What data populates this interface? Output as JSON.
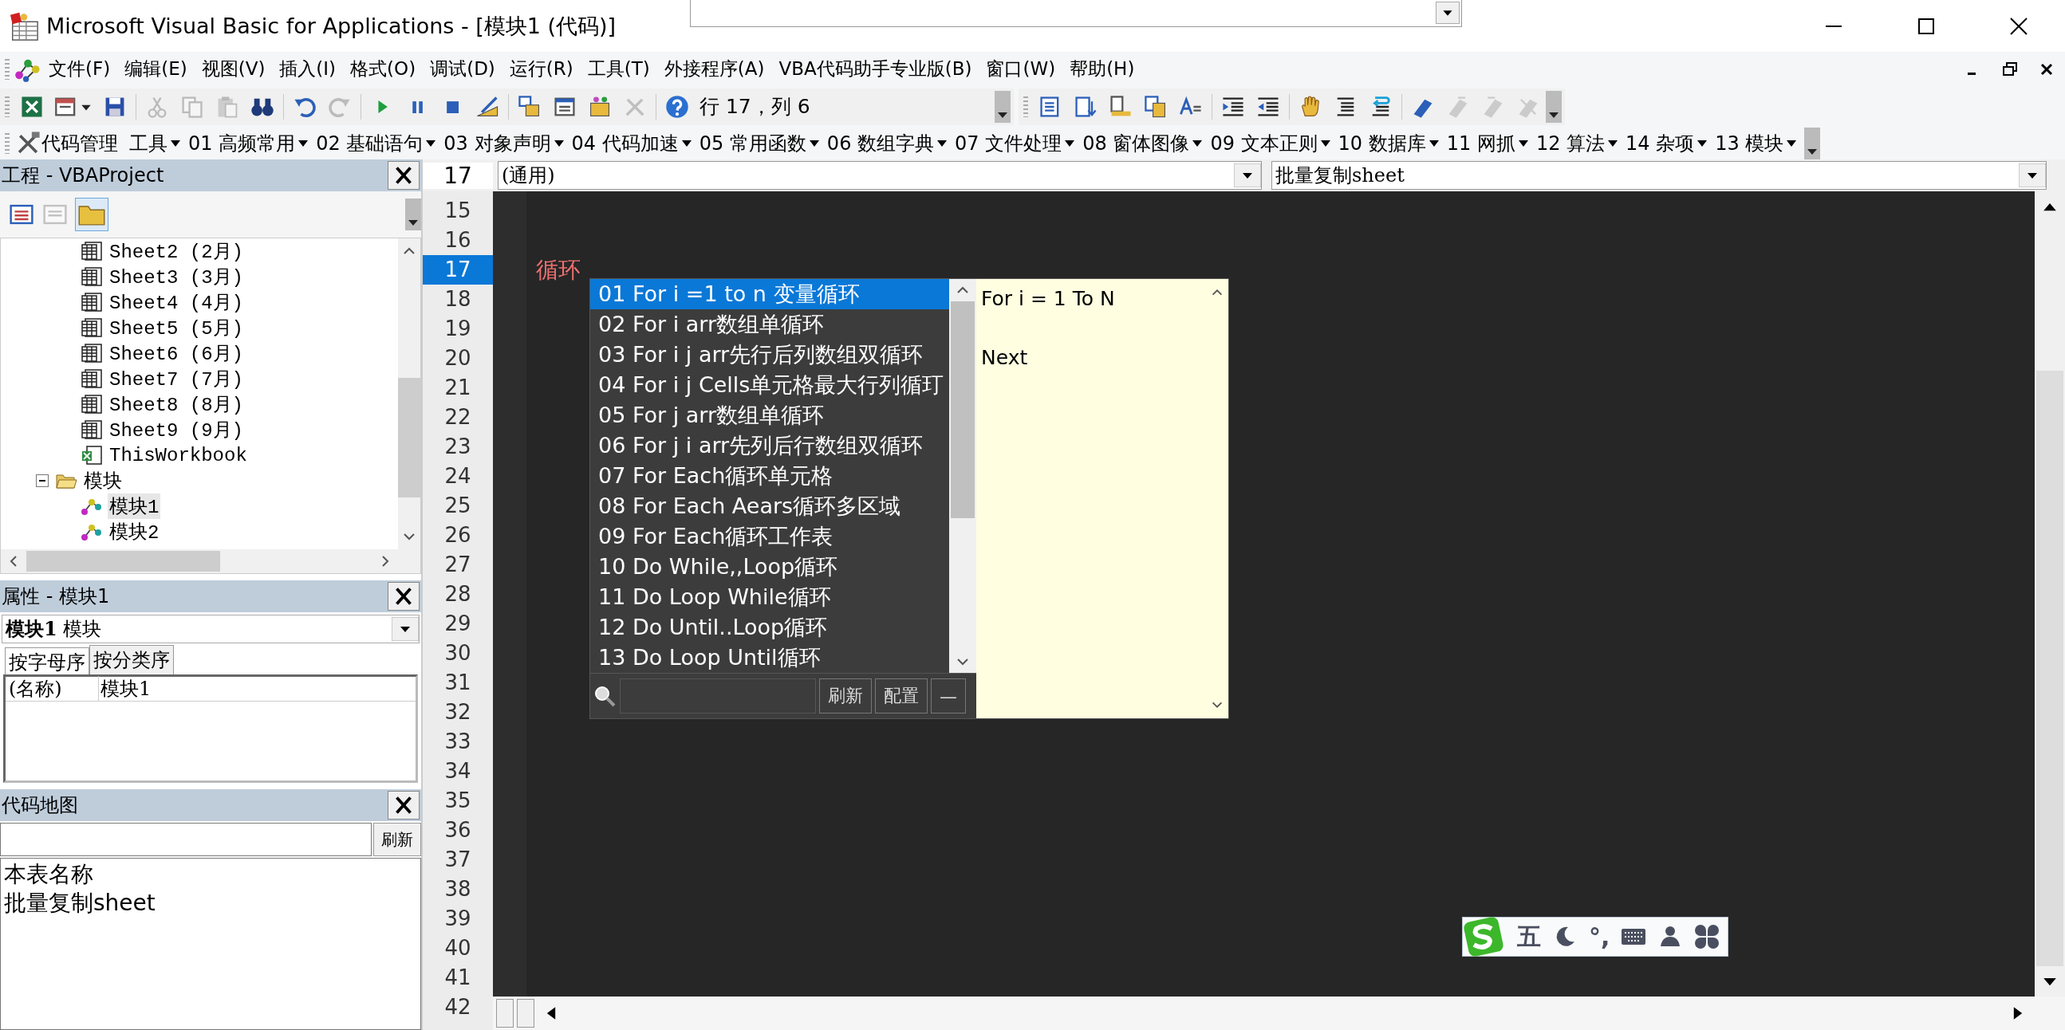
{
  "window": {
    "title": "Microsoft Visual Basic for Applications - [模块1 (代码)]"
  },
  "menu": [
    "文件(F)",
    "编辑(E)",
    "视图(V)",
    "插入(I)",
    "格式(O)",
    "调试(D)",
    "运行(R)",
    "工具(T)",
    "外接程序(A)",
    "VBA代码助手专业版(B)",
    "窗口(W)",
    "帮助(H)"
  ],
  "standard_toolbar": {
    "items": [
      {
        "kind": "spreadsheet",
        "disabled": false
      },
      {
        "kind": "window-dropdown",
        "disabled": false
      },
      {
        "kind": "save",
        "disabled": false
      },
      {
        "kind": "separator"
      },
      {
        "kind": "scissors",
        "disabled": true
      },
      {
        "kind": "copy",
        "disabled": true
      },
      {
        "kind": "paste",
        "disabled": true
      },
      {
        "kind": "binoculars",
        "disabled": false
      },
      {
        "kind": "separator"
      },
      {
        "kind": "undo",
        "disabled": false
      },
      {
        "kind": "redo",
        "disabled": true
      },
      {
        "kind": "separator"
      },
      {
        "kind": "play",
        "disabled": false
      },
      {
        "kind": "pause",
        "disabled": false
      },
      {
        "kind": "stop",
        "disabled": false
      },
      {
        "kind": "ruler",
        "disabled": false
      },
      {
        "kind": "separator"
      },
      {
        "kind": "project",
        "disabled": false
      },
      {
        "kind": "properties",
        "disabled": false
      },
      {
        "kind": "objects",
        "disabled": false
      },
      {
        "kind": "tools",
        "disabled": true
      },
      {
        "kind": "separator"
      },
      {
        "kind": "help",
        "disabled": false
      }
    ],
    "position": "行 17，列 6"
  },
  "edit_toolbar": {
    "items": [
      {
        "kind": "list",
        "disabled": false
      },
      {
        "kind": "doc-arrow",
        "disabled": false
      },
      {
        "kind": "ruler-doc",
        "disabled": false
      },
      {
        "kind": "documents",
        "disabled": false
      },
      {
        "kind": "text-size",
        "disabled": false
      },
      {
        "kind": "separator"
      },
      {
        "kind": "indent",
        "disabled": false
      },
      {
        "kind": "outdent",
        "disabled": false
      },
      {
        "kind": "separator"
      },
      {
        "kind": "hand",
        "disabled": false
      },
      {
        "kind": "lines",
        "disabled": false
      },
      {
        "kind": "wrap-lines",
        "disabled": false
      },
      {
        "kind": "separator"
      },
      {
        "kind": "bookmark",
        "disabled": false
      },
      {
        "kind": "bookmark-next",
        "disabled": true
      },
      {
        "kind": "bookmark-prev",
        "disabled": true
      },
      {
        "kind": "bookmark-clear",
        "disabled": true
      }
    ]
  },
  "addin_toolbar": {
    "title": "代码管理",
    "menus": [
      "工具",
      "01 高频常用",
      "02 基础语句",
      "03 对象声明",
      "04 代码加速",
      "05 常用函数",
      "06 数组字典",
      "07 文件处理",
      "08 窗体图像",
      "09 文本正则",
      "10 数据库",
      "11 网抓",
      "12 算法",
      "14 杂项",
      "13 模块"
    ]
  },
  "project_panel": {
    "title": "工程 - VBAProject",
    "tree": [
      {
        "kind": "scrolled-parent",
        "children": [
          {
            "kind": "sheet",
            "label": "Sheet2 (2月)",
            "selected": false
          },
          {
            "kind": "sheet",
            "label": "Sheet3 (3月)",
            "selected": false
          },
          {
            "kind": "sheet",
            "label": "Sheet4 (4月)",
            "selected": false
          },
          {
            "kind": "sheet",
            "label": "Sheet5 (5月)",
            "selected": false
          },
          {
            "kind": "sheet",
            "label": "Sheet6 (6月)",
            "selected": false
          },
          {
            "kind": "sheet",
            "label": "Sheet7 (7月)",
            "selected": false
          },
          {
            "kind": "sheet",
            "label": "Sheet8 (8月)",
            "selected": false
          },
          {
            "kind": "sheet",
            "label": "Sheet9 (9月)",
            "selected": false
          },
          {
            "kind": "workbook",
            "label": "ThisWorkbook",
            "selected": false
          }
        ]
      },
      {
        "kind": "folder",
        "label": "模块",
        "expanded": true,
        "selected": false,
        "children": [
          {
            "kind": "module",
            "label": "模块1",
            "selected": true
          },
          {
            "kind": "module",
            "label": "模块2",
            "selected": false
          }
        ]
      }
    ]
  },
  "properties_panel": {
    "title": "属性 - 模块1",
    "object": "**模块1** 模块",
    "tabs": [
      {
        "label": "按字母序",
        "selected": true
      },
      {
        "label": "按分类序",
        "selected": false
      }
    ],
    "rows": [
      {
        "name": "(名称)",
        "value": "模块1"
      }
    ]
  },
  "code_map_panel": {
    "title": "代码地图",
    "refresh": "刷新",
    "items": [
      "本表名称",
      "批量复制sheet"
    ]
  },
  "code_window": {
    "current_line": "17",
    "object_combo": "(通用)",
    "procedure_combo": "批量复制sheet",
    "lines": [
      {
        "number": "15",
        "selected": false
      },
      {
        "number": "16",
        "selected": false
      },
      {
        "number": "17",
        "selected": true,
        "code": "循环"
      },
      {
        "number": "18",
        "selected": false
      },
      {
        "number": "19",
        "selected": false
      },
      {
        "number": "20",
        "selected": false
      },
      {
        "number": "21",
        "selected": false
      },
      {
        "number": "22",
        "selected": false
      },
      {
        "number": "23",
        "selected": false
      },
      {
        "number": "24",
        "selected": false
      },
      {
        "number": "25",
        "selected": false
      },
      {
        "number": "26",
        "selected": false
      },
      {
        "number": "27",
        "selected": false
      },
      {
        "number": "28",
        "selected": false
      },
      {
        "number": "29",
        "selected": false
      },
      {
        "number": "30",
        "selected": false
      },
      {
        "number": "31",
        "selected": false
      },
      {
        "number": "32",
        "selected": false
      },
      {
        "number": "33",
        "selected": false
      },
      {
        "number": "34",
        "selected": false
      },
      {
        "number": "35",
        "selected": false
      },
      {
        "number": "36",
        "selected": false
      },
      {
        "number": "37",
        "selected": false
      },
      {
        "number": "38",
        "selected": false
      },
      {
        "number": "39",
        "selected": false
      },
      {
        "number": "40",
        "selected": false
      },
      {
        "number": "41",
        "selected": false
      },
      {
        "number": "42",
        "selected": false
      }
    ]
  },
  "snippet_popup": {
    "items": [
      {
        "label": "01 For i =1 to n 变量循环",
        "selected": true
      },
      {
        "label": "02 For i arr数组单循环",
        "selected": false
      },
      {
        "label": "03 For i j arr先行后列数组双循环",
        "selected": false
      },
      {
        "label": "04 For i j Cells单元格最大行列循玎",
        "selected": false
      },
      {
        "label": "05 For j arr数组单循环",
        "selected": false
      },
      {
        "label": "06 For j i arr先列后行数组双循环",
        "selected": false
      },
      {
        "label": "07 For Each循环单元格",
        "selected": false
      },
      {
        "label": "08 For Each Aears循环多区域",
        "selected": false
      },
      {
        "label": "09 For Each循环工作表",
        "selected": false
      },
      {
        "label": "10 Do While,,Loop循环",
        "selected": false
      },
      {
        "label": "11 Do Loop While循环",
        "selected": false
      },
      {
        "label": "12 Do Until..Loop循环",
        "selected": false
      },
      {
        "label": "13 Do Loop Until循环",
        "selected": false
      }
    ],
    "buttons": [
      "刷新",
      "配置",
      "—"
    ],
    "preview": "For i = 1 To N\n\nNext"
  },
  "ime_toolbar": {
    "mode": "五",
    "punctuation": "°,"
  }
}
